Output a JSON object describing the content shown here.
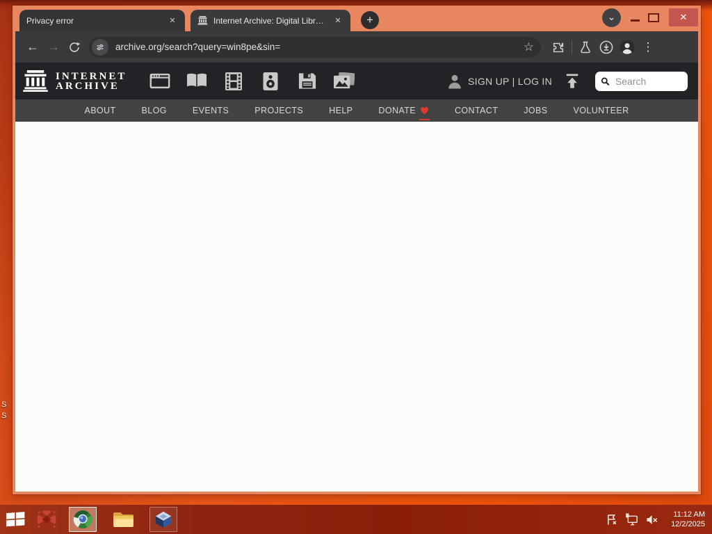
{
  "browser": {
    "tab_privacy": {
      "title": "Privacy error",
      "close_glyph": "✕"
    },
    "tab_archive": {
      "title": "Internet Archive: Digital Library",
      "close_glyph": "✕"
    },
    "new_tab_glyph": "+",
    "controls": {
      "tab_search_glyph": "⌄",
      "close_glyph": "✕"
    },
    "toolbar": {
      "back_glyph": "←",
      "forward_glyph": "→",
      "url": "archive.org/search?query=win8pe&sin=",
      "bookmark_glyph": "☆",
      "menu_glyph": "⋮"
    }
  },
  "archive_page": {
    "wordmark_line1": "INTERNET",
    "wordmark_line2": "ARCHIVE",
    "auth_text": "SIGN UP | LOG IN",
    "search_placeholder": "Search",
    "nav_items": [
      "ABOUT",
      "BLOG",
      "EVENTS",
      "PROJECTS",
      "HELP",
      "DONATE",
      "CONTACT",
      "JOBS",
      "VOLUNTEER"
    ],
    "colors": {
      "donate_heart": "#e03a2a",
      "header_bg": "#222326",
      "nav_bg": "#434343"
    }
  },
  "desktop": {
    "icon_label_1": "S",
    "icon_label_2": "S"
  },
  "taskbar": {
    "time": "11:12 AM",
    "date": "12/2/2025"
  }
}
